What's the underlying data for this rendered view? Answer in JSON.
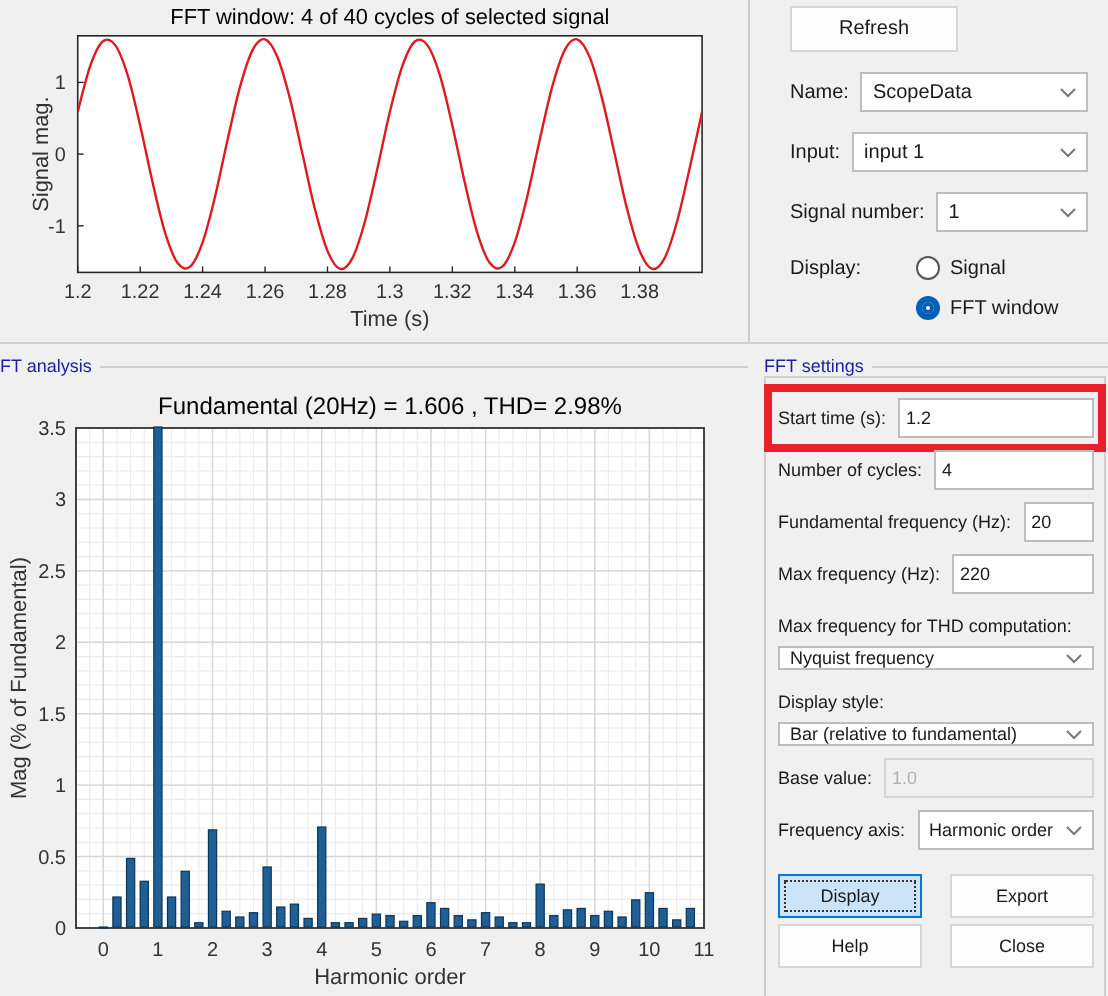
{
  "signal_plot": {
    "chart_data": {
      "type": "line",
      "title": "FFT window: 4 of 40 cycles of selected signal",
      "xlabel": "Time (s)",
      "ylabel": "Signal mag.",
      "x": [
        1.2,
        1.204,
        1.208,
        1.212,
        1.216,
        1.22,
        1.224,
        1.228,
        1.232,
        1.236,
        1.24,
        1.244,
        1.248,
        1.252,
        1.256,
        1.26,
        1.264,
        1.268,
        1.272,
        1.276,
        1.28,
        1.284,
        1.288,
        1.292,
        1.296,
        1.3,
        1.304,
        1.308,
        1.312,
        1.316,
        1.32,
        1.324,
        1.328,
        1.332,
        1.336,
        1.34,
        1.344,
        1.348,
        1.352,
        1.356,
        1.36,
        1.364,
        1.368,
        1.372,
        1.376,
        1.38,
        1.384,
        1.388,
        1.392,
        1.396,
        1.4
      ],
      "series": [
        {
          "color": "#e0191e",
          "values": [
            0.59,
            1.23,
            1.57,
            1.52,
            1.1,
            0.4,
            -0.4,
            -1.1,
            -1.52,
            -1.57,
            -1.23,
            -0.59,
            0.2,
            0.94,
            1.45,
            1.6,
            1.35,
            0.77,
            0,
            -0.77,
            -1.35,
            -1.6,
            -1.45,
            -0.94,
            -0.2,
            0.59,
            1.23,
            1.57,
            1.52,
            1.1,
            0.4,
            -0.4,
            -1.1,
            -1.52,
            -1.57,
            -1.23,
            -0.59,
            0.2,
            0.94,
            1.45,
            1.6,
            1.35,
            0.77,
            0,
            -0.77,
            -1.35,
            -1.6,
            -1.45,
            -0.94,
            -0.2,
            0.59
          ]
        }
      ],
      "xlim": [
        1.2,
        1.4
      ],
      "ylim": [
        -1.65,
        1.65
      ],
      "xticks": [
        1.2,
        1.22,
        1.24,
        1.26,
        1.28,
        1.3,
        1.32,
        1.34,
        1.36,
        1.38
      ],
      "yticks": [
        -1,
        0,
        1
      ]
    }
  },
  "fft_analysis": {
    "group_label": "FT analysis",
    "chart_data": {
      "type": "bar",
      "title": "Fundamental (20Hz) = 1.606 , THD= 2.98%",
      "xlabel": "Harmonic order",
      "ylabel": "Mag (% of Fundamental)",
      "x": [
        0,
        0.25,
        0.5,
        0.75,
        1,
        1.25,
        1.5,
        1.75,
        2,
        2.25,
        2.5,
        2.75,
        3,
        3.25,
        3.5,
        3.75,
        4,
        4.25,
        4.5,
        4.75,
        5,
        5.25,
        5.5,
        5.75,
        6,
        6.25,
        6.5,
        6.75,
        7,
        7.25,
        7.5,
        7.75,
        8,
        8.25,
        8.5,
        8.75,
        9,
        9.25,
        9.5,
        9.75,
        10,
        10.25,
        10.5,
        10.75
      ],
      "values": [
        0,
        0.21,
        0.48,
        0.32,
        3.5,
        0.21,
        0.39,
        0.03,
        0.68,
        0.11,
        0.07,
        0.1,
        0.42,
        0.14,
        0.16,
        0.06,
        0.7,
        0.03,
        0.03,
        0.06,
        0.09,
        0.08,
        0.04,
        0.08,
        0.17,
        0.13,
        0.08,
        0.05,
        0.1,
        0.07,
        0.03,
        0.03,
        0.3,
        0.08,
        0.12,
        0.13,
        0.08,
        0.11,
        0.07,
        0.19,
        0.24,
        0.13,
        0.05,
        0.13
      ],
      "grid": true,
      "xlim": [
        -0.5,
        11
      ],
      "ylim": [
        0,
        3.5
      ],
      "xticks": [
        0,
        1,
        2,
        3,
        4,
        5,
        6,
        7,
        8,
        9,
        10,
        11
      ],
      "yticks": [
        0,
        0.5,
        1,
        1.5,
        2,
        2.5,
        3,
        3.5
      ]
    }
  },
  "signal_selection": {
    "refresh_button": "Refresh",
    "fields": [
      {
        "label": "Name:",
        "value": "ScopeData"
      },
      {
        "label": "Input:",
        "value": "input 1"
      },
      {
        "label": "Signal number:",
        "value": "1"
      }
    ],
    "display": {
      "label": "Display:",
      "options": [
        {
          "label": "Signal",
          "selected": false
        },
        {
          "label": "FFT window",
          "selected": true
        }
      ]
    }
  },
  "fft_settings": {
    "group_label": "FFT settings",
    "fields": [
      {
        "kind": "text",
        "label": "Start time (s):",
        "value": "1.2",
        "highlighted": true,
        "disabled": false
      },
      {
        "kind": "text",
        "label": "Number of cycles:",
        "value": "4",
        "highlighted": false,
        "disabled": false
      },
      {
        "kind": "text",
        "label": "Fundamental frequency (Hz):",
        "value": "20",
        "highlighted": false,
        "disabled": false
      },
      {
        "kind": "text",
        "label": "Max frequency (Hz):",
        "value": "220",
        "highlighted": false,
        "disabled": false
      },
      {
        "kind": "stacked-dropdown",
        "label": "Max frequency for THD computation:",
        "value": "Nyquist frequency",
        "highlighted": false,
        "disabled": false
      },
      {
        "kind": "stacked-dropdown",
        "label": "Display style:",
        "value": "Bar (relative to fundamental)",
        "highlighted": false,
        "disabled": false
      },
      {
        "kind": "text",
        "label": "Base value:",
        "value": "1.0",
        "highlighted": false,
        "disabled": true
      },
      {
        "kind": "dropdown",
        "label": "Frequency axis:",
        "value": "Harmonic order",
        "highlighted": false,
        "disabled": false
      }
    ],
    "buttons": [
      {
        "label": "Display",
        "focused": true
      },
      {
        "label": "Export",
        "focused": false
      },
      {
        "label": "Help",
        "focused": false
      },
      {
        "label": "Close",
        "focused": false
      }
    ]
  }
}
